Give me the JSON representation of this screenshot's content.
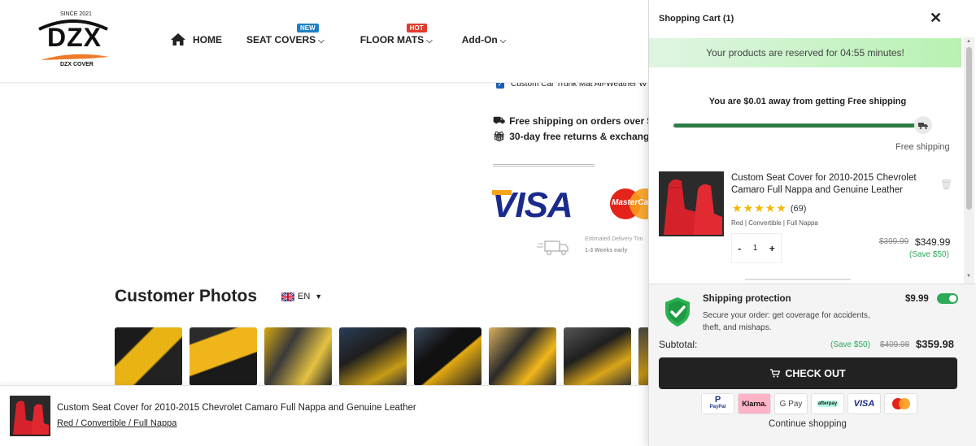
{
  "brand": {
    "since": "SINCE 2021",
    "logo_text": "DZX",
    "tagline": "DZX COVER"
  },
  "nav": {
    "home": "HOME",
    "seat_covers": "SEAT COVERS",
    "seat_covers_badge": "NEW",
    "floor_mats": "FLOOR MATS",
    "floor_mats_badge": "HOT",
    "addon": "Add-On",
    "chevron": "⌵"
  },
  "product_details": {
    "trunk_mat": "Custom Car Trunk Mat All-Weather W",
    "free_shipping": "Free shipping on orders over $3",
    "returns": "30-day free returns & exchange",
    "visa": "VISA",
    "mastercard": "MasterCa",
    "delivery_title": "Estimated Delivery Tim",
    "delivery_time": "1-3 Weeks early"
  },
  "customer_photos": {
    "title": "Customer Photos",
    "language": "EN",
    "photo_count": 8
  },
  "sticky_bar": {
    "title": "Custom Seat Cover for 2010-2015 Chevrolet Camaro Full Nappa and Genuine Leather",
    "variant": "Red / Convertible / Full Nappa"
  },
  "cart": {
    "title": "Shopping Cart (1)",
    "close": "✕",
    "reserve_msg": "Your products are reserved for 04:55 minutes!",
    "shipping_msg": "You are $0.01 away from getting Free shipping",
    "shipping_progress": 0.99,
    "free_shipping_label": "Free shipping",
    "item": {
      "title": "Custom Seat Cover for 2010-2015 Chevrolet Camaro Full Nappa and Genuine Leather",
      "rating": 5,
      "review_count": "(69)",
      "variant": "Red | Convertible | Full Nappa",
      "quantity": "1",
      "minus": "-",
      "plus": "+",
      "price_old": "$399.99",
      "price_new": "$349.99",
      "save": "(Save $50)"
    },
    "protection": {
      "title": "Shipping protection",
      "desc": "Secure your order: get coverage for accidents, theft, and mishaps.",
      "price": "$9.99",
      "enabled": true
    },
    "subtotal": {
      "label": "Subtotal:",
      "save": "(Save $50)",
      "old": "$409.98",
      "total": "$359.98"
    },
    "checkout": "CHECK OUT",
    "payments": {
      "paypal": "PayPal",
      "klarna": "Klarna.",
      "gpay": "G Pay",
      "afterpay": "afterpay",
      "visa": "VISA"
    },
    "continue": "Continue shopping"
  }
}
